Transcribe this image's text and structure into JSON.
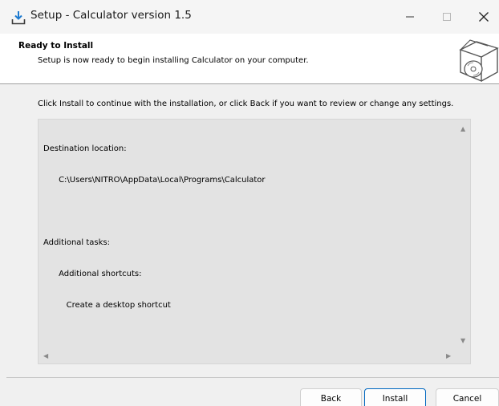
{
  "window": {
    "title": "Setup - Calculator version 1.5",
    "controls": [
      "minimize",
      "maximize",
      "close"
    ]
  },
  "header": {
    "title": "Ready to Install",
    "subtitle": "Setup is now ready to begin installing Calculator on your computer.",
    "icon": "install-disc-box-icon"
  },
  "instruction": "Click Install to continue with the installation, or click Back if you want to review or change any settings.",
  "memo": {
    "lines": [
      "Destination location:",
      "      C:\\Users\\NITRO\\AppData\\Local\\Programs\\Calculator",
      "",
      "Additional tasks:",
      "      Additional shortcuts:",
      "         Create a desktop shortcut"
    ]
  },
  "buttons": {
    "back": "Back",
    "install": "Install",
    "cancel": "Cancel"
  },
  "colors": {
    "accent": "#0067c0",
    "header_bg": "#ffffff",
    "body_bg": "#f0f0f0",
    "memo_bg": "#e3e3e3"
  }
}
